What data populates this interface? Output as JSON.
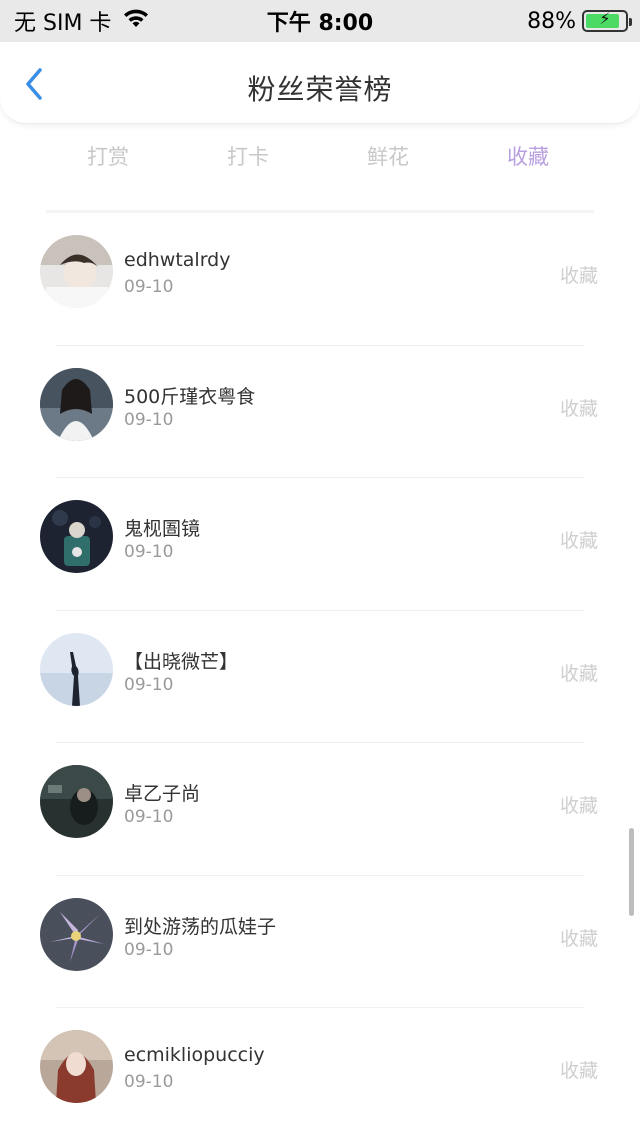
{
  "status_bar": {
    "carrier": "无 SIM 卡",
    "time": "下午 8:00",
    "battery_percent": "88%",
    "battery_level": 0.88,
    "icons": [
      "wifi-icon",
      "battery-charging-icon"
    ]
  },
  "nav": {
    "title": "粉丝荣誉榜",
    "back_icon": "chevron-left-icon",
    "accent_color": "#3a8ee6"
  },
  "tabs": [
    {
      "label": "打赏",
      "active": false
    },
    {
      "label": "打卡",
      "active": false
    },
    {
      "label": "鲜花",
      "active": false
    },
    {
      "label": "收藏",
      "active": true
    }
  ],
  "tab_active_color": "#b9a0e0",
  "list": {
    "items": [
      {
        "name": "edhwtalrdy",
        "date": "09-10",
        "action": "收藏",
        "avatar": "avatar-photo-boy"
      },
      {
        "name": "500斤瑾衣粤食",
        "date": "09-10",
        "action": "收藏",
        "avatar": "avatar-photo-girl-white-dress"
      },
      {
        "name": "鬼枧圄镜",
        "date": "09-10",
        "action": "收藏",
        "avatar": "avatar-illustration-dark"
      },
      {
        "name": "【出晓微芒】",
        "date": "09-10",
        "action": "收藏",
        "avatar": "avatar-photo-silhouette-sky"
      },
      {
        "name": "卓乙子尚",
        "date": "09-10",
        "action": "收藏",
        "avatar": "avatar-photo-dark-scene"
      },
      {
        "name": "到处游荡的瓜娃子",
        "date": "09-10",
        "action": "收藏",
        "avatar": "avatar-photo-flower"
      },
      {
        "name": "ecmikliopucciy",
        "date": "09-10",
        "action": "收藏",
        "avatar": "avatar-photo-girl-redhair"
      }
    ]
  }
}
